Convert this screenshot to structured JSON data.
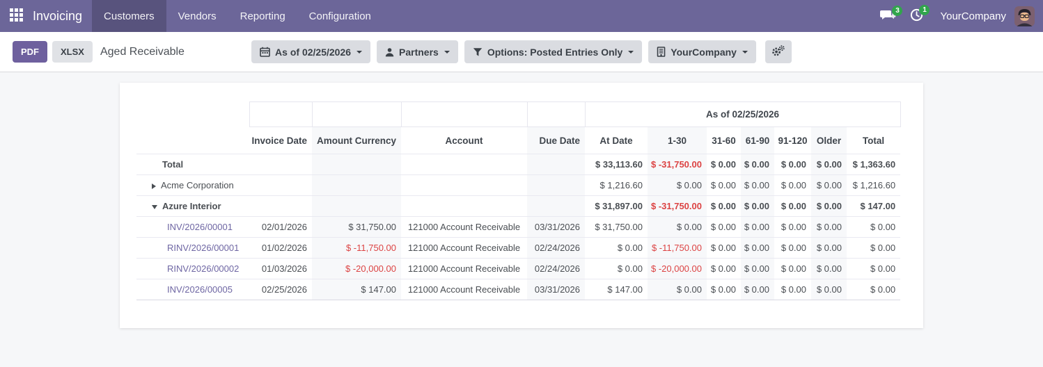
{
  "navbar": {
    "app_name": "Invoicing",
    "menu_items": [
      {
        "label": "Customers",
        "active": true
      },
      {
        "label": "Vendors",
        "active": false
      },
      {
        "label": "Reporting",
        "active": false
      },
      {
        "label": "Configuration",
        "active": false
      }
    ],
    "messages_badge": "3",
    "activities_badge": "1",
    "company_name": "YourCompany"
  },
  "toolbar": {
    "pdf_label": "PDF",
    "xlsx_label": "XLSX",
    "title": "Aged Receivable",
    "filters": [
      {
        "icon": "calendar-icon",
        "label": "As of 02/25/2026"
      },
      {
        "icon": "user-icon",
        "label": "Partners"
      },
      {
        "icon": "filter-icon",
        "label": "Options: Posted Entries Only"
      },
      {
        "icon": "building-icon",
        "label": "YourCompany"
      }
    ]
  },
  "table": {
    "group_header": "As of 02/25/2026",
    "columns": [
      "",
      "Invoice Date",
      "Amount Currency",
      "Account",
      "Due Date",
      "At Date",
      "1-30",
      "31-60",
      "61-90",
      "91-120",
      "Older",
      "Total"
    ],
    "rows": [
      {
        "type": "total",
        "bold": true,
        "label": "Total",
        "values": [
          "",
          "",
          "",
          "",
          "$ 33,113.60",
          {
            "text": "$ -31,750.00",
            "red": true
          },
          "$ 0.00",
          "$ 0.00",
          "$ 0.00",
          "$ 0.00",
          "$ 1,363.60"
        ]
      },
      {
        "type": "group",
        "bold": false,
        "expanded": false,
        "label": "Acme Corporation",
        "values": [
          "",
          "",
          "",
          "",
          "$ 1,216.60",
          "$ 0.00",
          "$ 0.00",
          "$ 0.00",
          "$ 0.00",
          "$ 0.00",
          "$ 1,216.60"
        ]
      },
      {
        "type": "group",
        "bold": true,
        "expanded": true,
        "label": "Azure Interior",
        "values": [
          "",
          "",
          "",
          "",
          "$ 31,897.00",
          {
            "text": "$ -31,750.00",
            "red": true
          },
          "$ 0.00",
          "$ 0.00",
          "$ 0.00",
          "$ 0.00",
          "$ 147.00"
        ]
      },
      {
        "type": "line",
        "bold": false,
        "label": "INV/2026/00001",
        "values": [
          "02/01/2026",
          "$ 31,750.00",
          "121000 Account Receivable",
          "03/31/2026",
          "$ 31,750.00",
          "$ 0.00",
          "$ 0.00",
          "$ 0.00",
          "$ 0.00",
          "$ 0.00",
          "$ 0.00"
        ]
      },
      {
        "type": "line",
        "bold": false,
        "label": "RINV/2026/00001",
        "values": [
          "01/02/2026",
          {
            "text": "$ -11,750.00",
            "red": true
          },
          "121000 Account Receivable",
          "02/24/2026",
          "$ 0.00",
          {
            "text": "$ -11,750.00",
            "red": true
          },
          "$ 0.00",
          "$ 0.00",
          "$ 0.00",
          "$ 0.00",
          "$ 0.00"
        ]
      },
      {
        "type": "line",
        "bold": false,
        "label": "RINV/2026/00002",
        "values": [
          "01/03/2026",
          {
            "text": "$ -20,000.00",
            "red": true
          },
          "121000 Account Receivable",
          "02/24/2026",
          "$ 0.00",
          {
            "text": "$ -20,000.00",
            "red": true
          },
          "$ 0.00",
          "$ 0.00",
          "$ 0.00",
          "$ 0.00",
          "$ 0.00"
        ]
      },
      {
        "type": "line",
        "bold": false,
        "label": "INV/2026/00005",
        "values": [
          "02/25/2026",
          "$ 147.00",
          "121000 Account Receivable",
          "03/31/2026",
          "$ 147.00",
          "$ 0.00",
          "$ 0.00",
          "$ 0.00",
          "$ 0.00",
          "$ 0.00",
          "$ 0.00"
        ]
      }
    ]
  },
  "colors": {
    "navbar_bg": "#6c6699",
    "primary_purple": "#6e609e",
    "link_purple": "#6e66a3",
    "negative_red": "#dc4343",
    "badge_green": "#31a54c"
  }
}
